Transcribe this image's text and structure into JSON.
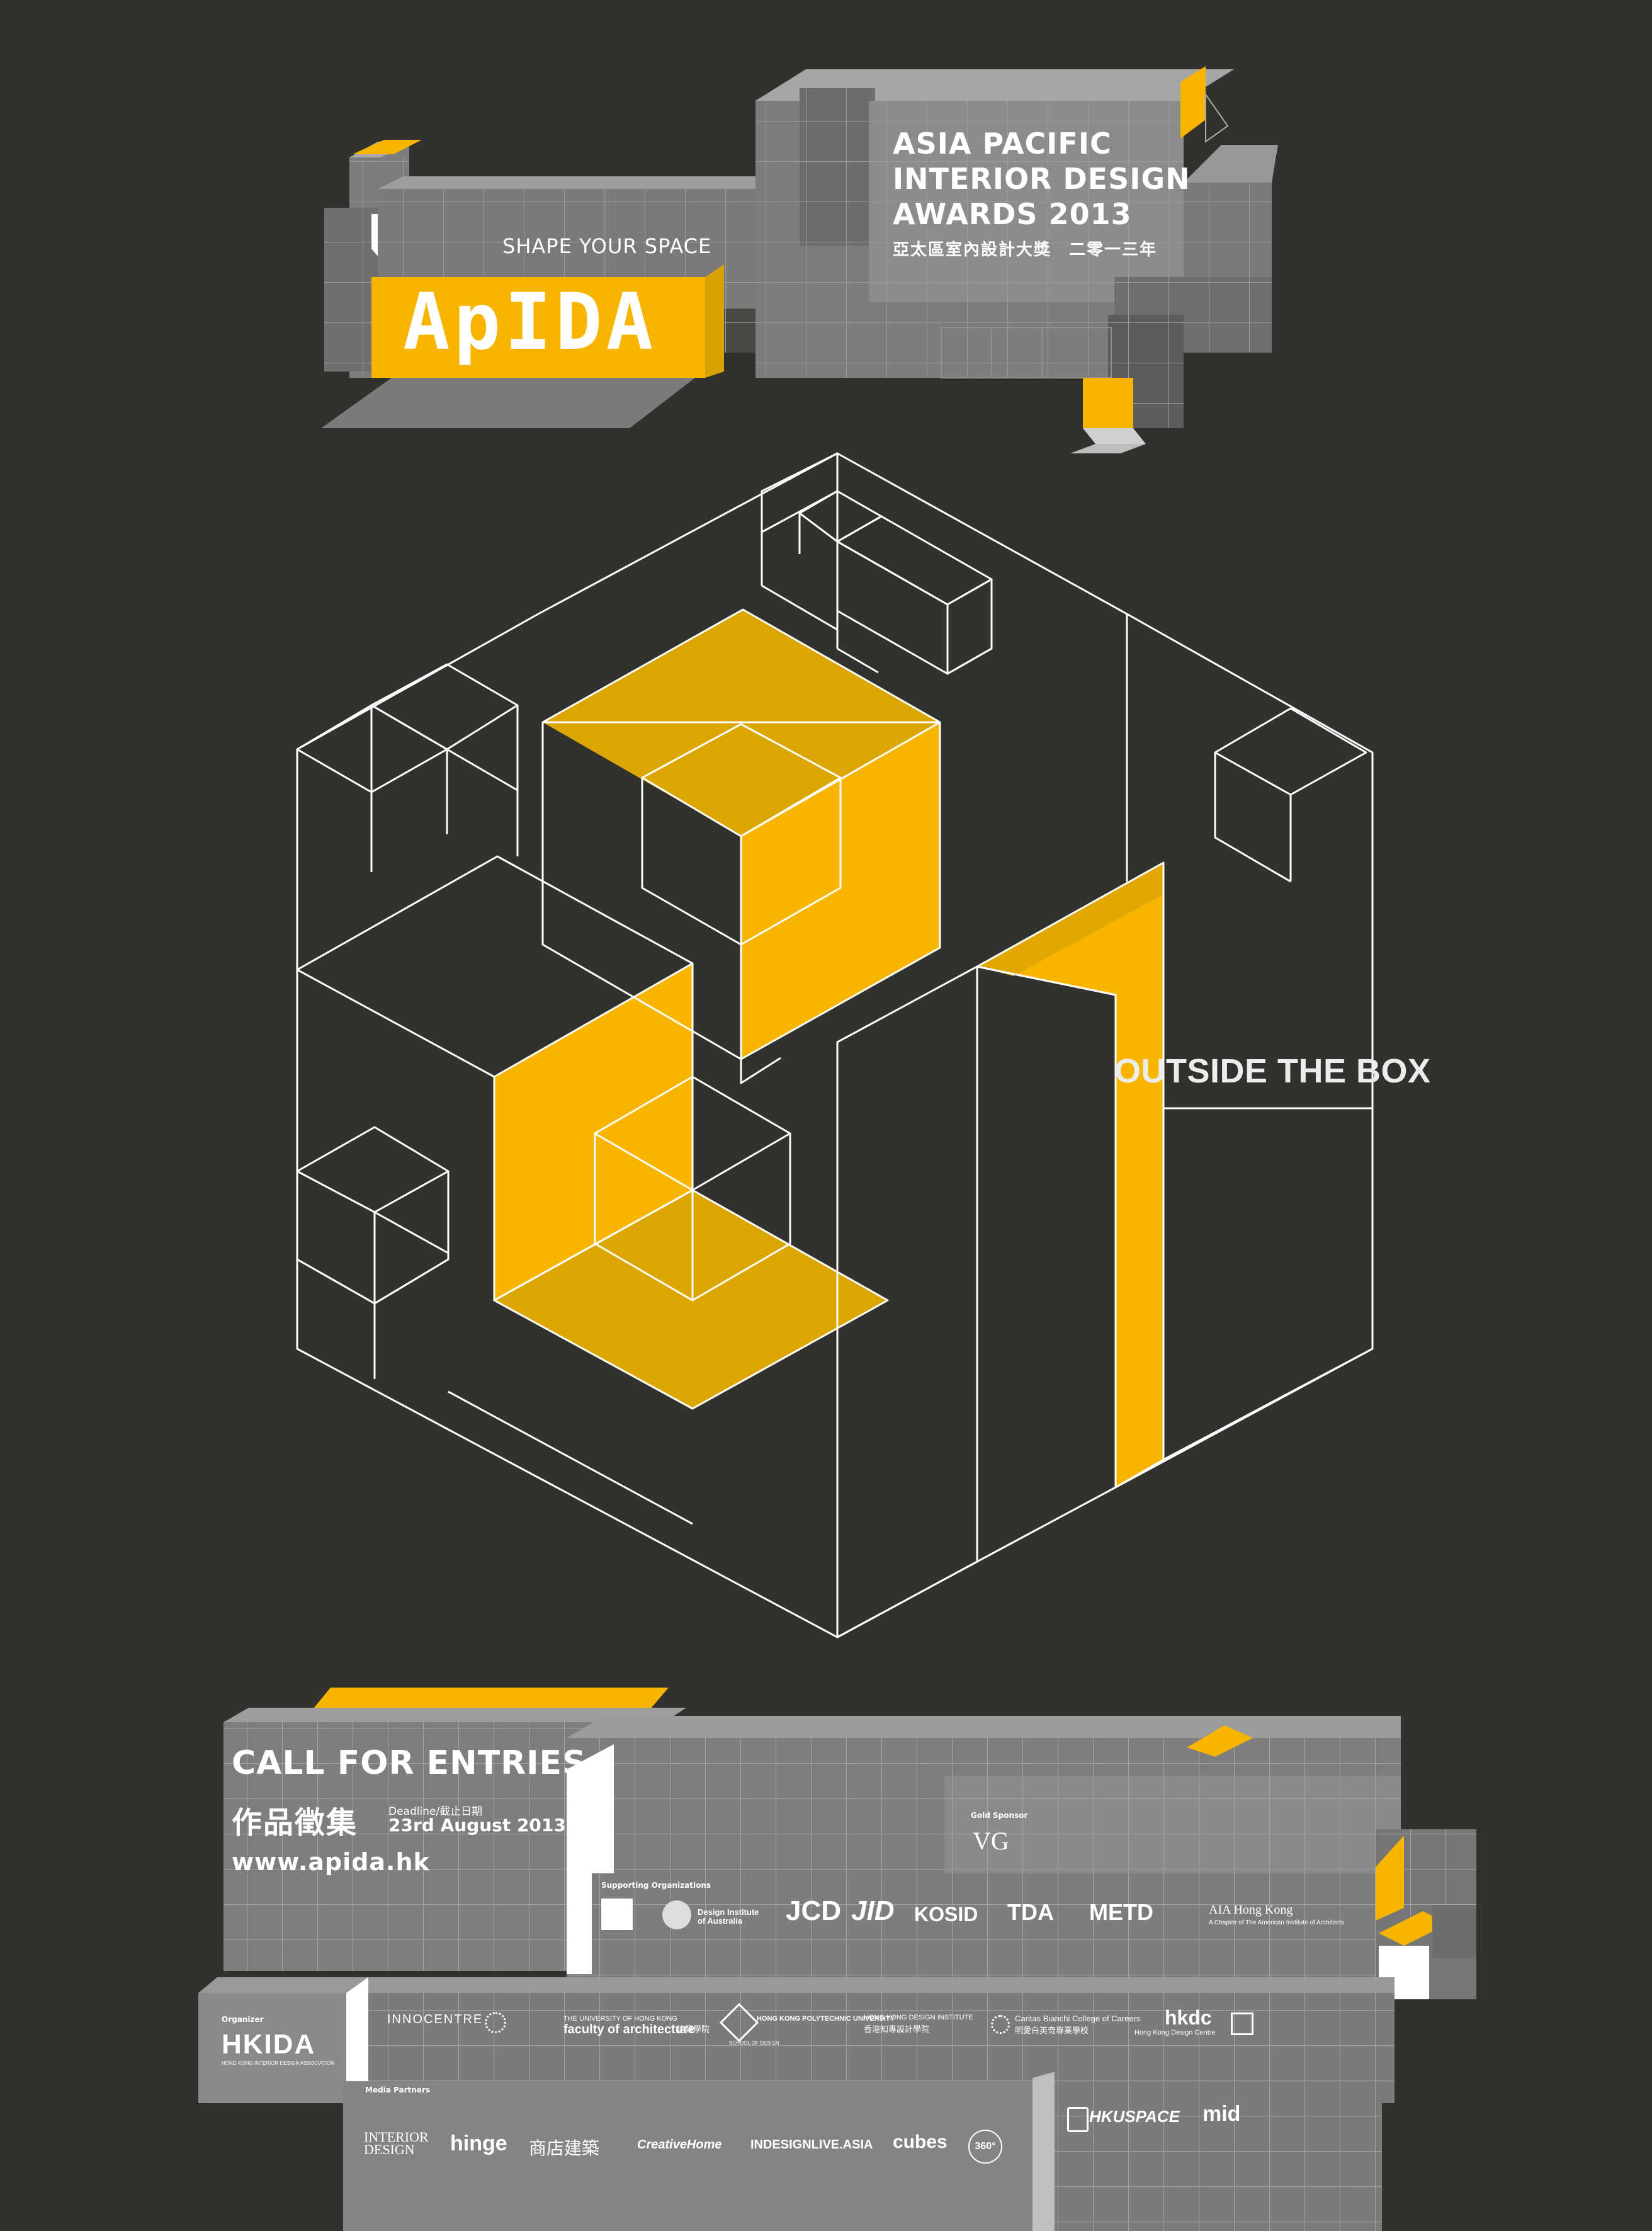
{
  "header": {
    "title_lines": [
      "ASIA PACIFIC",
      "INTERIOR DESIGN",
      "AWARDS 2013"
    ],
    "title_cn": "亞太區室內設計大獎　二零一三年",
    "tagline": "SHAPE YOUR SPACE",
    "logo": "ApIDA"
  },
  "graphic": {
    "tagline": "OUTSIDE THE BOX"
  },
  "footer": {
    "call": "CALL FOR ENTRIES",
    "call_cn": "作品徵集",
    "deadline_label": "Deadline/截止日期",
    "deadline_date": "23rd August 2013",
    "website": "www.apida.hk",
    "gold_sponsor_label": "Gold Sponsor",
    "gold_sponsor": "VG",
    "supporting_label": "Supporting Organizations",
    "supporting": [
      "Design Institute of Australia",
      "JCD",
      "JID",
      "KOSID",
      "TDA",
      "METD",
      "AIA Hong Kong"
    ],
    "aia_sub": "A Chapter of The American Institute of Architects",
    "organizer_label": "Organizer",
    "organizer": "HKIDA",
    "organizer_sub": "HONG KONG INTERIOR DESIGN ASSOCIATION",
    "partners": [
      "INNOCENTRE",
      "THE UNIVERSITY OF HONG KONG",
      "faculty of architecture",
      "HONG KONG POLYTECHNIC UNIVERSITY",
      "SCHOOL OF DESIGN",
      "HONG KONG DESIGN INSTITUTE",
      "Caritas Bianchi College of Careers",
      "hkdc",
      "Hong Kong Design Centre"
    ],
    "partner_cn": [
      "建築學院",
      "香港知專設計學院",
      "明愛白英奇專業學校"
    ],
    "media_label": "Media Partners",
    "media": [
      "INTERIOR DESIGN",
      "hinge",
      "商店建築",
      "CreativeHome",
      "INDESIGNLIVE.ASIA",
      "cubes",
      "360°",
      "HKUSPACE",
      "mid"
    ]
  },
  "colors": {
    "background": "#33312e",
    "accent": "#f8b500",
    "accent_dark": "#d9a200",
    "grey_block": "#828282",
    "line": "#ffffff"
  }
}
